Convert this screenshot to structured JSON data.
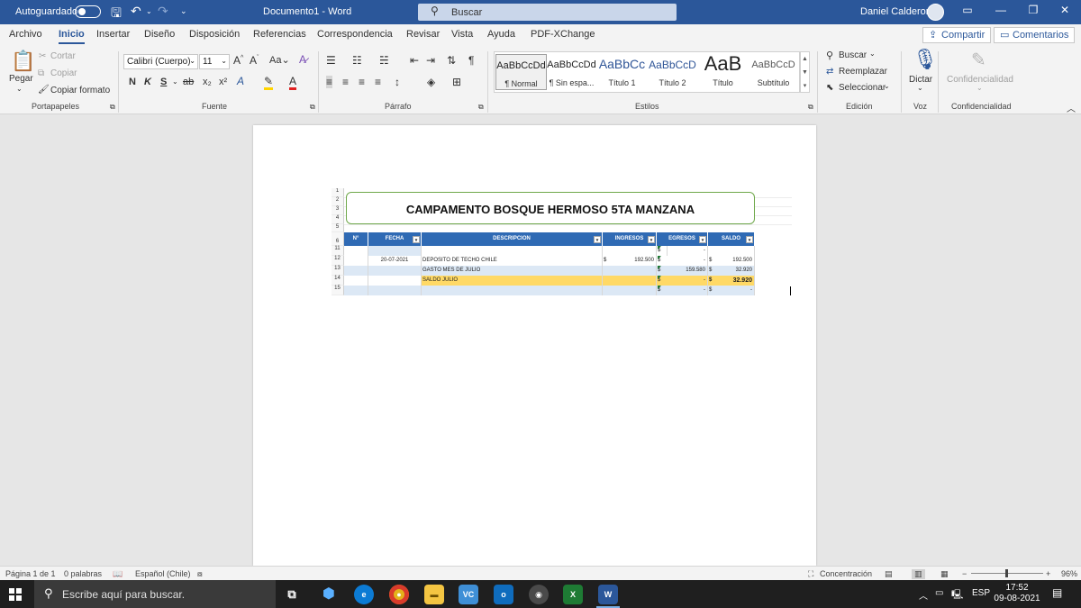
{
  "titlebar": {
    "autosave_label": "Autoguardado",
    "doc_title": "Documento1  -  Word",
    "search_placeholder": "Buscar",
    "user_name": "Daniel Calderon"
  },
  "menu": {
    "tabs": [
      "Archivo",
      "Inicio",
      "Insertar",
      "Diseño",
      "Disposición",
      "Referencias",
      "Correspondencia",
      "Revisar",
      "Vista",
      "Ayuda",
      "PDF-XChange"
    ],
    "active_tab": "Inicio",
    "share_label": "Compartir",
    "comments_label": "Comentarios"
  },
  "ribbon": {
    "clipboard": {
      "paste": "Pegar",
      "cut": "Cortar",
      "copy": "Copiar",
      "format_painter": "Copiar formato",
      "group": "Portapapeles"
    },
    "font": {
      "name": "Calibri (Cuerpo)",
      "size": "11",
      "bold": "N",
      "italic": "K",
      "underline": "S",
      "group": "Fuente"
    },
    "paragraph": {
      "group": "Párrafo"
    },
    "styles": {
      "items": [
        {
          "sample": "AaBbCcDd",
          "name": "¶ Normal"
        },
        {
          "sample": "AaBbCcDd",
          "name": "¶ Sin espa..."
        },
        {
          "sample": "AaBbCc",
          "name": "Título 1"
        },
        {
          "sample": "AaBbCcD",
          "name": "Título 2"
        },
        {
          "sample": "AaB",
          "name": "Título"
        },
        {
          "sample": "AaBbCcD",
          "name": "Subtítulo"
        }
      ],
      "group": "Estilos"
    },
    "editing": {
      "find": "Buscar",
      "replace": "Reemplazar",
      "select": "Seleccionar",
      "group": "Edición"
    },
    "voice": {
      "dictate": "Dictar",
      "group": "Voz"
    },
    "sensitivity": {
      "label": "Confidencialidad",
      "group": "Confidencialidad"
    }
  },
  "sheet": {
    "title": "CAMPAMENTO BOSQUE HERMOSO 5TA MANZANA",
    "headers": [
      "N°",
      "FECHA",
      "DESCRIPCION",
      "INGRESOS",
      "EGRESOS",
      "SALDO"
    ],
    "row_numbers": [
      "1",
      "2",
      "3",
      "4",
      "5",
      "6",
      "11",
      "12",
      "13",
      "14",
      "15"
    ],
    "rows": [
      {
        "num": "11",
        "fecha": "",
        "descripcion": "",
        "ingresos": "",
        "egresos_cur": "$",
        "egresos": "-",
        "saldo_cur": "",
        "saldo": ""
      },
      {
        "num": "12",
        "fecha": "20-07-2021",
        "descripcion": "DEPOSITO DE TECHO CHILE",
        "ingresos_cur": "$",
        "ingresos": "192.500",
        "egresos_cur": "$",
        "egresos": "-",
        "saldo_cur": "$",
        "saldo": "192.500"
      },
      {
        "num": "13",
        "fecha": "",
        "descripcion": "GASTO MES DE JULIO",
        "ingresos": "",
        "egresos_cur": "$",
        "egresos": "159.580",
        "saldo_cur": "$",
        "saldo": "32.920"
      },
      {
        "num": "14",
        "fecha": "",
        "descripcion": "SALDO JULIO",
        "ingresos": "",
        "egresos_cur": "$",
        "egresos": "-",
        "saldo_cur": "$",
        "saldo": "32.920"
      },
      {
        "num": "15",
        "fecha": "",
        "descripcion": "",
        "ingresos": "",
        "egresos_cur": "$",
        "egresos": "-",
        "saldo_cur": "$",
        "saldo": "-"
      }
    ]
  },
  "statusbar": {
    "page": "Página 1 de 1",
    "words": "0 palabras",
    "language": "Español (Chile)",
    "focus": "Concentración",
    "zoom": "96%"
  },
  "taskbar": {
    "search_placeholder": "Escribe aquí para buscar.",
    "language": "ESP",
    "time": "17:52",
    "date": "09-08-2021"
  }
}
